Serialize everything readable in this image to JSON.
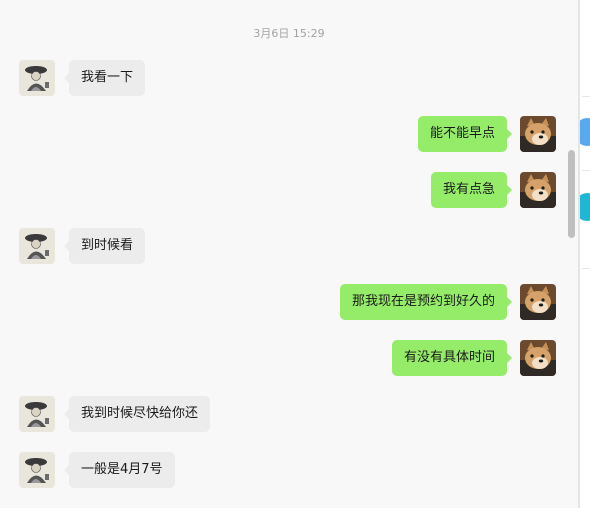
{
  "timestamp": "3月6日 15:29",
  "messages": [
    {
      "side": "left",
      "text": "我看一下"
    },
    {
      "side": "right",
      "text": "能不能早点"
    },
    {
      "side": "right",
      "text": "我有点急"
    },
    {
      "side": "left",
      "text": "到时候看"
    },
    {
      "side": "right",
      "text": "那我现在是预约到好久的"
    },
    {
      "side": "right",
      "text": "有没有具体时间"
    },
    {
      "side": "left",
      "text": "我到时候尽快给你还"
    },
    {
      "side": "left",
      "text": "一般是4月7号"
    }
  ],
  "colors": {
    "sent_bubble": "#95ec69",
    "received_bubble": "#ececec",
    "background": "#f8f8f9",
    "side_accent_blue": "#5aa9ef",
    "side_accent_teal": "#1fb7d3"
  },
  "icons": {
    "contact_avatar": "ink-painting-figure-avatar",
    "my_avatar": "shiba-dog-avatar"
  }
}
